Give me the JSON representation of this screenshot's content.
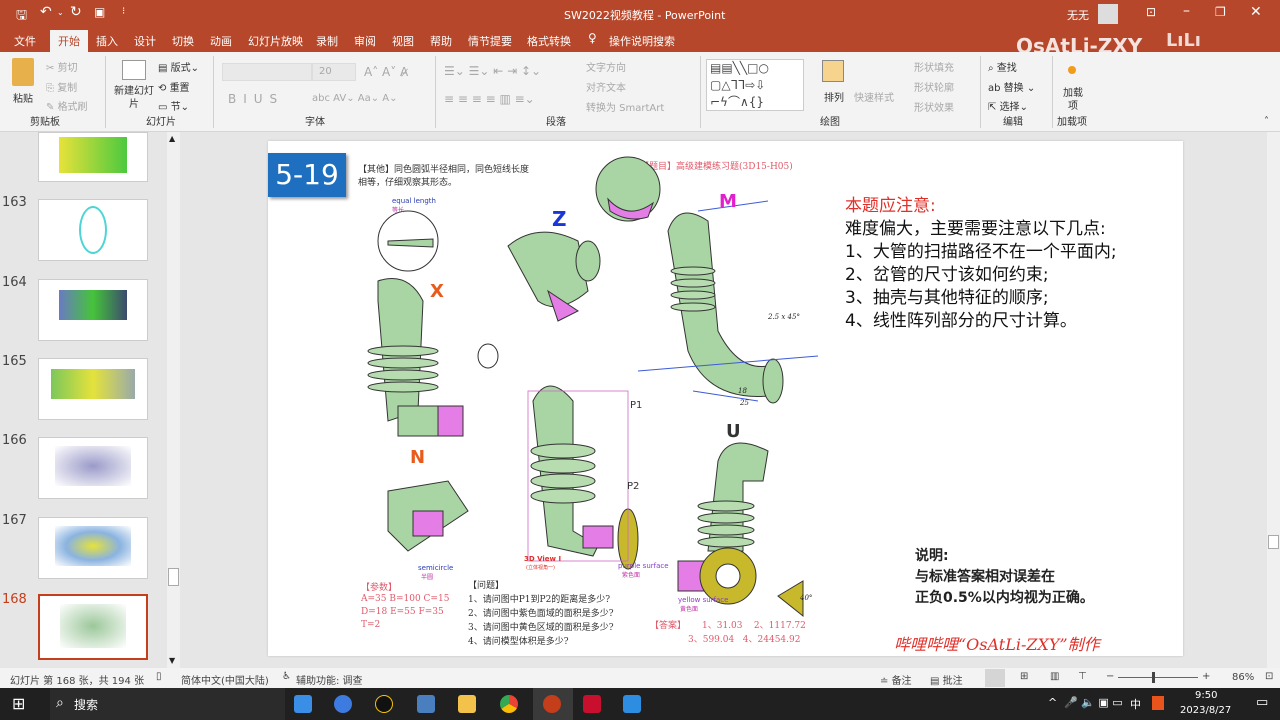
{
  "window": {
    "title": "SW2022视频教程 - PowerPoint",
    "user": "无无",
    "watermark": "OsAtLi-ZXY"
  },
  "tabs": [
    "文件",
    "开始",
    "插入",
    "设计",
    "切换",
    "动画",
    "幻灯片放映",
    "录制",
    "审阅",
    "视图",
    "帮助",
    "情节提要",
    "格式转换"
  ],
  "search_tell": "操作说明搜索",
  "ribbon": {
    "clipboard": {
      "paste": "粘贴",
      "cut": "剪切",
      "copy": "复制",
      "format_painter": "格式刷",
      "label": "剪贴板"
    },
    "slides": {
      "new_slide": "新建幻灯片",
      "layout": "版式",
      "reset": "重置",
      "section": "节",
      "label": "幻灯片"
    },
    "font": {
      "size": "20",
      "label": "字体"
    },
    "paragraph": {
      "text_direction": "文字方向",
      "align_text": "对齐文本",
      "smartart": "转换为 SmartArt",
      "label": "段落"
    },
    "drawing": {
      "arrange": "排列",
      "quick_styles": "快速样式",
      "fill": "形状填充",
      "outline": "形状轮廓",
      "effects": "形状效果",
      "label": "绘图"
    },
    "editing": {
      "find": "查找",
      "replace": "替换",
      "select": "选择",
      "label": "编辑"
    },
    "addins": {
      "addins": "加载项",
      "label": "加载项"
    }
  },
  "thumbnails": [
    {
      "num": "163"
    },
    {
      "num": "164"
    },
    {
      "num": "165"
    },
    {
      "num": "166"
    },
    {
      "num": "167"
    },
    {
      "num": "168"
    }
  ],
  "slide": {
    "badge": "5-19",
    "note_line1": "【其他】同色圆弧半径相同，同色短线长度",
    "note_line2": "相等，仔细观察其形态。",
    "title": "【题目】高级建模练习题(3D15-H05)",
    "attention_title": "本题应注意:",
    "attention_intro": "难度偏大，主要需要注意以下几点:",
    "attention_items": [
      "1、大管的扫描路径不在一个平面内;",
      "2、岔管的尺寸该如何约束;",
      "3、抽壳与其他特征的顺序;",
      "4、线性阵列部分的尺寸计算。"
    ],
    "explain_title": "说明:",
    "explain_line1": "与标准答案相对误差在",
    "explain_line2": "正负0.5%以内均视为正确。",
    "footer": "哔哩哔哩“OsAtLi-ZXY”制作",
    "params_title": "【参数】",
    "params": [
      "A=35   B=100   C=15",
      "D=18   E=55   F=35",
      "T=2"
    ],
    "questions_title": "【问题】",
    "questions": [
      "1、请问图中P1到P2的距离是多少?",
      "2、请问图中紫色面域的面积是多少?",
      "3、请问图中黄色区域的面积是多少?",
      "4、请问模型体积是多少?"
    ],
    "answer_label": "【答案】",
    "answers_line1": "1、31.03    2、1117.72",
    "answers_line2": "3、599.04   4、24454.92",
    "labels": {
      "equal_length": "equal length",
      "equal_length_cn": "等长",
      "semicircle": "semicircle",
      "semicircle_cn": "半圆",
      "view": "3D View I",
      "view_cn": "(立体视角一)",
      "purple": "purple surface",
      "purple_cn": "紫色面",
      "yellow": "yellow surface",
      "yellow_cn": "黄色面",
      "p1": "P1",
      "p2": "P2",
      "x": "X",
      "z": "Z",
      "m": "M",
      "n": "N",
      "u": "U",
      "dim_25": "25",
      "dim_18": "18",
      "dim_chamfer": "2.5 x 45°",
      "dim_40": "40°"
    }
  },
  "status": {
    "slide_info": "幻灯片 第 168 张，共 194 张",
    "language": "简体中文(中国大陆)",
    "accessibility": "辅助功能: 调查",
    "notes": "备注",
    "comments": "批注",
    "zoom": "86%",
    "zoom_fraction": 0.43
  },
  "taskbar": {
    "search": "搜索",
    "time": "9:50",
    "date": "2023/8/27",
    "ime": "中"
  },
  "colors": {
    "accent": "#b7472a",
    "badge": "#1e6fbf",
    "red": "#e0302a"
  }
}
